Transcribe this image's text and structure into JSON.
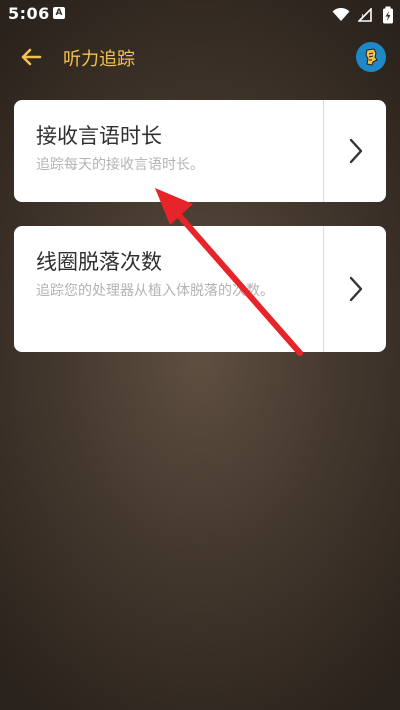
{
  "status_bar": {
    "time": "5:06",
    "notification_icon_letter": "A",
    "icons": [
      "wifi-icon",
      "signal-icon",
      "battery-charging-icon"
    ]
  },
  "app_bar": {
    "title": "听力追踪",
    "back_icon": "arrow-left-icon",
    "account_icon": "account-icon"
  },
  "cards": [
    {
      "title": "接收言语时长",
      "description": "追踪每天的接收言语时长。",
      "action_icon": "chevron-right-icon"
    },
    {
      "title": "线圈脱落次数",
      "description": "追踪您的处理器从植入体脱落的次数。",
      "action_icon": "chevron-right-icon"
    }
  ],
  "colors": {
    "accent": "#f2c150",
    "annotation_arrow": "#e8242b",
    "account_badge": "#1f88c7"
  },
  "annotation": {
    "type": "red-arrow",
    "points_to": "card-1"
  }
}
